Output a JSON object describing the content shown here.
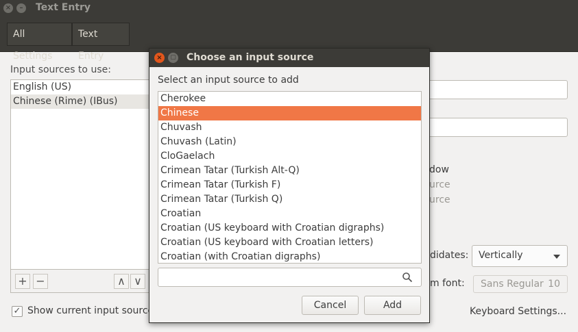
{
  "window": {
    "title": "Text Entry"
  },
  "breadcrumb": [
    "All Settings",
    "Text Entry"
  ],
  "input_sources": {
    "label": "Input sources to use:",
    "items": [
      "English (US)",
      "Chinese (Rime) (IBus)"
    ],
    "selected_index": 1
  },
  "list_toolbar": {
    "add": "+",
    "remove": "−",
    "up": "∧",
    "down": "∨"
  },
  "show_current": {
    "label": "Show current input source",
    "checked": true
  },
  "right_panel": {
    "text1": "dow",
    "text2": "urce",
    "text3": "urce",
    "candidates_label": "didates:",
    "candidates_value": "Vertically",
    "font_label": "m font:",
    "font_name": "Sans Regular",
    "font_size": "10",
    "keyboard_settings": "Keyboard Settings..."
  },
  "dialog": {
    "title": "Choose an input source",
    "subtitle": "Select an input source to add",
    "items": [
      "Cherokee",
      "Chinese",
      "Chuvash",
      "Chuvash (Latin)",
      "CloGaelach",
      "Crimean Tatar (Turkish Alt-Q)",
      "Crimean Tatar (Turkish F)",
      "Crimean Tatar (Turkish Q)",
      "Croatian",
      "Croatian (US keyboard with Croatian digraphs)",
      "Croatian (US keyboard with Croatian letters)",
      "Croatian (with Croatian digraphs)"
    ],
    "selected_index": 1,
    "search_value": "",
    "cancel_label": "Cancel",
    "add_label": "Add"
  },
  "colors": {
    "accent": "#f07746",
    "titlebar": "#3c3b37",
    "close": "#e2561c"
  }
}
